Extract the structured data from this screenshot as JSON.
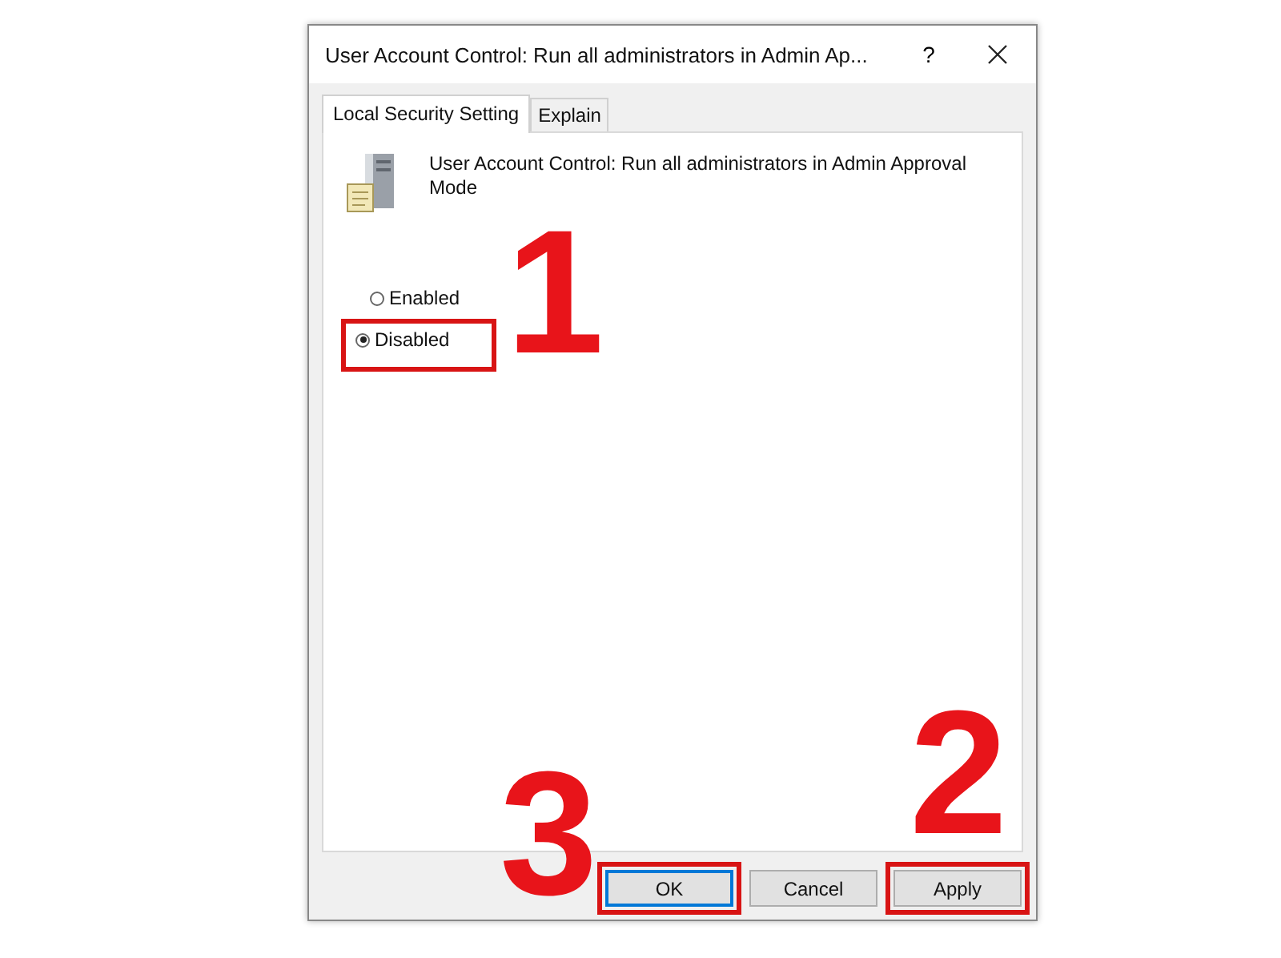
{
  "window": {
    "title": "User Account Control: Run all administrators in Admin Ap...",
    "help": "?"
  },
  "tabs": [
    {
      "label": "Local Security Setting",
      "selected": true
    },
    {
      "label": "Explain",
      "selected": false
    }
  ],
  "policy": {
    "name": "User Account Control: Run all administrators in Admin Approval Mode"
  },
  "options": [
    {
      "label": "Enabled",
      "selected": false,
      "highlighted": false
    },
    {
      "label": "Disabled",
      "selected": true,
      "highlighted": true
    }
  ],
  "buttons": [
    {
      "label": "OK",
      "default": true,
      "highlighted": true
    },
    {
      "label": "Cancel",
      "default": false,
      "highlighted": false
    },
    {
      "label": "Apply",
      "default": false,
      "highlighted": true
    }
  ],
  "annotations": [
    {
      "label": "1"
    },
    {
      "label": "2"
    },
    {
      "label": "3"
    }
  ]
}
